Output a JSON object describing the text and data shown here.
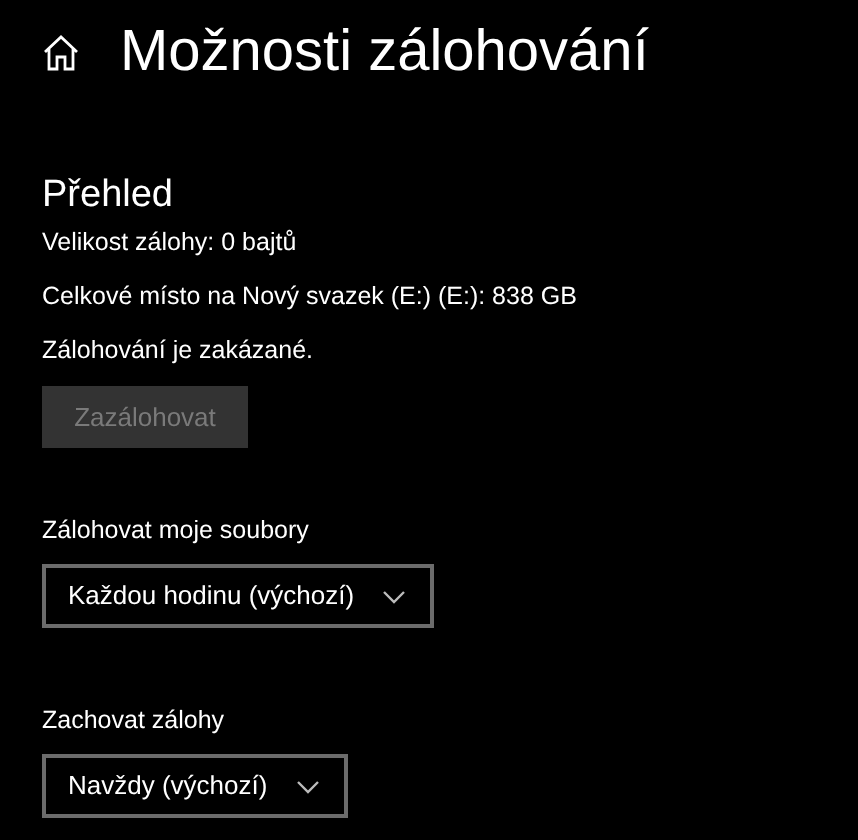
{
  "page": {
    "title": "Možnosti zálohování"
  },
  "overview": {
    "heading": "Přehled",
    "lines": [
      "Velikost zálohy: 0 bajtů",
      "Celkové místo na Nový svazek (E:) (E:): 838 GB",
      "Zálohování je zakázané."
    ],
    "button": {
      "label": "Zazálohovat",
      "disabled": true
    }
  },
  "settings": [
    {
      "label": "Zálohovat moje soubory",
      "value": "Každou hodinu (výchozí)"
    },
    {
      "label": "Zachovat zálohy",
      "value": "Navždy (výchozí)"
    }
  ]
}
